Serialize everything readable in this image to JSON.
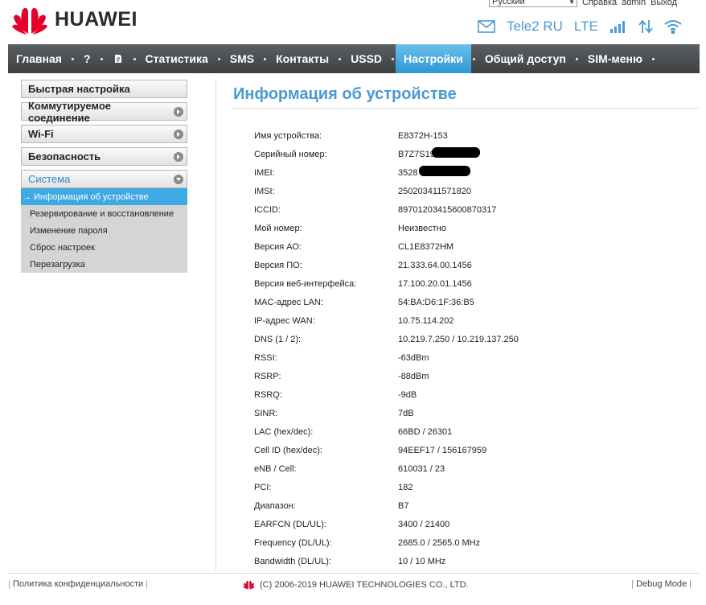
{
  "brand": {
    "name": "HUAWEI",
    "accent": "#4a9ad0",
    "logo_red": "#e4002b"
  },
  "top_links": {
    "language": "Русский",
    "help": "Справка",
    "user": "admin",
    "logout": "Выход"
  },
  "status": {
    "operator": "Tele2 RU",
    "network": "LTE",
    "icons": [
      "mail-icon",
      "signal-icon",
      "data-transfer-icon",
      "wifi-icon"
    ]
  },
  "nav": {
    "items": [
      {
        "label": "Главная"
      },
      {
        "label": "?"
      },
      {
        "label": ""
      },
      {
        "label": "Статистика"
      },
      {
        "label": "SMS"
      },
      {
        "label": "Контакты"
      },
      {
        "label": "USSD"
      },
      {
        "label": "Настройки",
        "active": true
      },
      {
        "label": "Общий доступ"
      },
      {
        "label": "SIM-меню"
      }
    ]
  },
  "sidebar": {
    "items": [
      {
        "label": "Быстрая настройка"
      },
      {
        "label": "Коммутируемое соединение"
      },
      {
        "label": "Wi-Fi"
      },
      {
        "label": "Безопасность"
      },
      {
        "label": "Система"
      }
    ],
    "sub_items": [
      {
        "label": "→ Информация об устройстве"
      },
      {
        "label": "Резервирование и восстановление"
      },
      {
        "label": "Изменение пароля"
      },
      {
        "label": "Сброс настроек"
      },
      {
        "label": "Перезагрузка"
      }
    ]
  },
  "main": {
    "title": "Информация об устройстве",
    "rows": [
      {
        "label": "Имя устройства:",
        "value": "E8372H-153"
      },
      {
        "label": "Серийный номер:",
        "value": "B7Z7S19"
      },
      {
        "label": "IMEI:",
        "value": "3528"
      },
      {
        "label": "IMSI:",
        "value": "250203411571820"
      },
      {
        "label": "ICCID:",
        "value": "89701203415600870317"
      },
      {
        "label": "Мой номер:",
        "value": "Неизвестно"
      },
      {
        "label": "Версия АО:",
        "value": "CL1E8372HM"
      },
      {
        "label": "Версия ПО:",
        "value": "21.333.64.00.1456"
      },
      {
        "label": "Версия веб-интерфейса:",
        "value": "17.100.20.01.1456"
      },
      {
        "label": "MAC-адрес LAN:",
        "value": "54:BA:D6:1F:36:B5"
      },
      {
        "label": "IP-адрес WAN:",
        "value": "10.75.114.202"
      },
      {
        "label": "DNS (1 / 2):",
        "value": "10.219.7.250 / 10.219.137.250"
      },
      {
        "label": "RSSI:",
        "value": "-63dBm"
      },
      {
        "label": "RSRP:",
        "value": "-88dBm"
      },
      {
        "label": "RSRQ:",
        "value": "-9dB"
      },
      {
        "label": "SINR:",
        "value": "7dB"
      },
      {
        "label": "LAC (hex/dec):",
        "value": "66BD / 26301"
      },
      {
        "label": "Cell ID (hex/dec):",
        "value": "94EEF17 / 156167959"
      },
      {
        "label": "eNB / Cell:",
        "value": "610031 / 23"
      },
      {
        "label": "PCI:",
        "value": "182"
      },
      {
        "label": "Диапазон:",
        "value": "B7"
      },
      {
        "label": "EARFCN (DL/UL):",
        "value": "3400 / 21400"
      },
      {
        "label": "Frequency (DL/UL):",
        "value": "2685.0 / 2565.0 MHz"
      },
      {
        "label": "Bandwidth (DL/UL):",
        "value": "10 / 10 MHz"
      }
    ]
  },
  "footer": {
    "privacy": "Политика конфиденциальности",
    "copyright": "(C) 2006-2019 HUAWEI TECHNOLOGIES CO., LTD.",
    "debug": "Debug Mode"
  }
}
